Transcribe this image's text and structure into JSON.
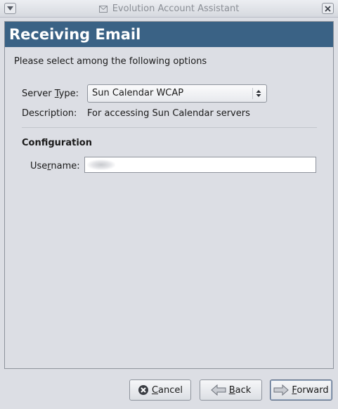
{
  "window": {
    "title": "Evolution Account Assistant"
  },
  "page": {
    "heading": "Receiving Email",
    "intro": "Please select among the following options"
  },
  "server_type": {
    "label_pre": "Server ",
    "label_key": "T",
    "label_post": "ype:",
    "selected": "Sun Calendar WCAP"
  },
  "description": {
    "label": "Description:",
    "value": "For accessing Sun Calendar servers"
  },
  "configuration": {
    "heading": "Configuration",
    "username_pre": "Use",
    "username_key": "r",
    "username_post": "name:",
    "username_value": ""
  },
  "buttons": {
    "cancel_key": "C",
    "cancel_rest": "ancel",
    "back_key": "B",
    "back_rest": "ack",
    "forward_key": "F",
    "forward_rest": "orward"
  },
  "icons": {
    "window_menu": "down-arrow-icon",
    "window_close": "close-icon",
    "title": "envelope-icon",
    "combo": "updown-arrows-icon",
    "cancel": "cancel-icon",
    "back": "back-arrow-icon",
    "forward": "forward-arrow-icon"
  },
  "colors": {
    "header_bg": "#3a6285",
    "window_bg": "#dcdee4"
  }
}
